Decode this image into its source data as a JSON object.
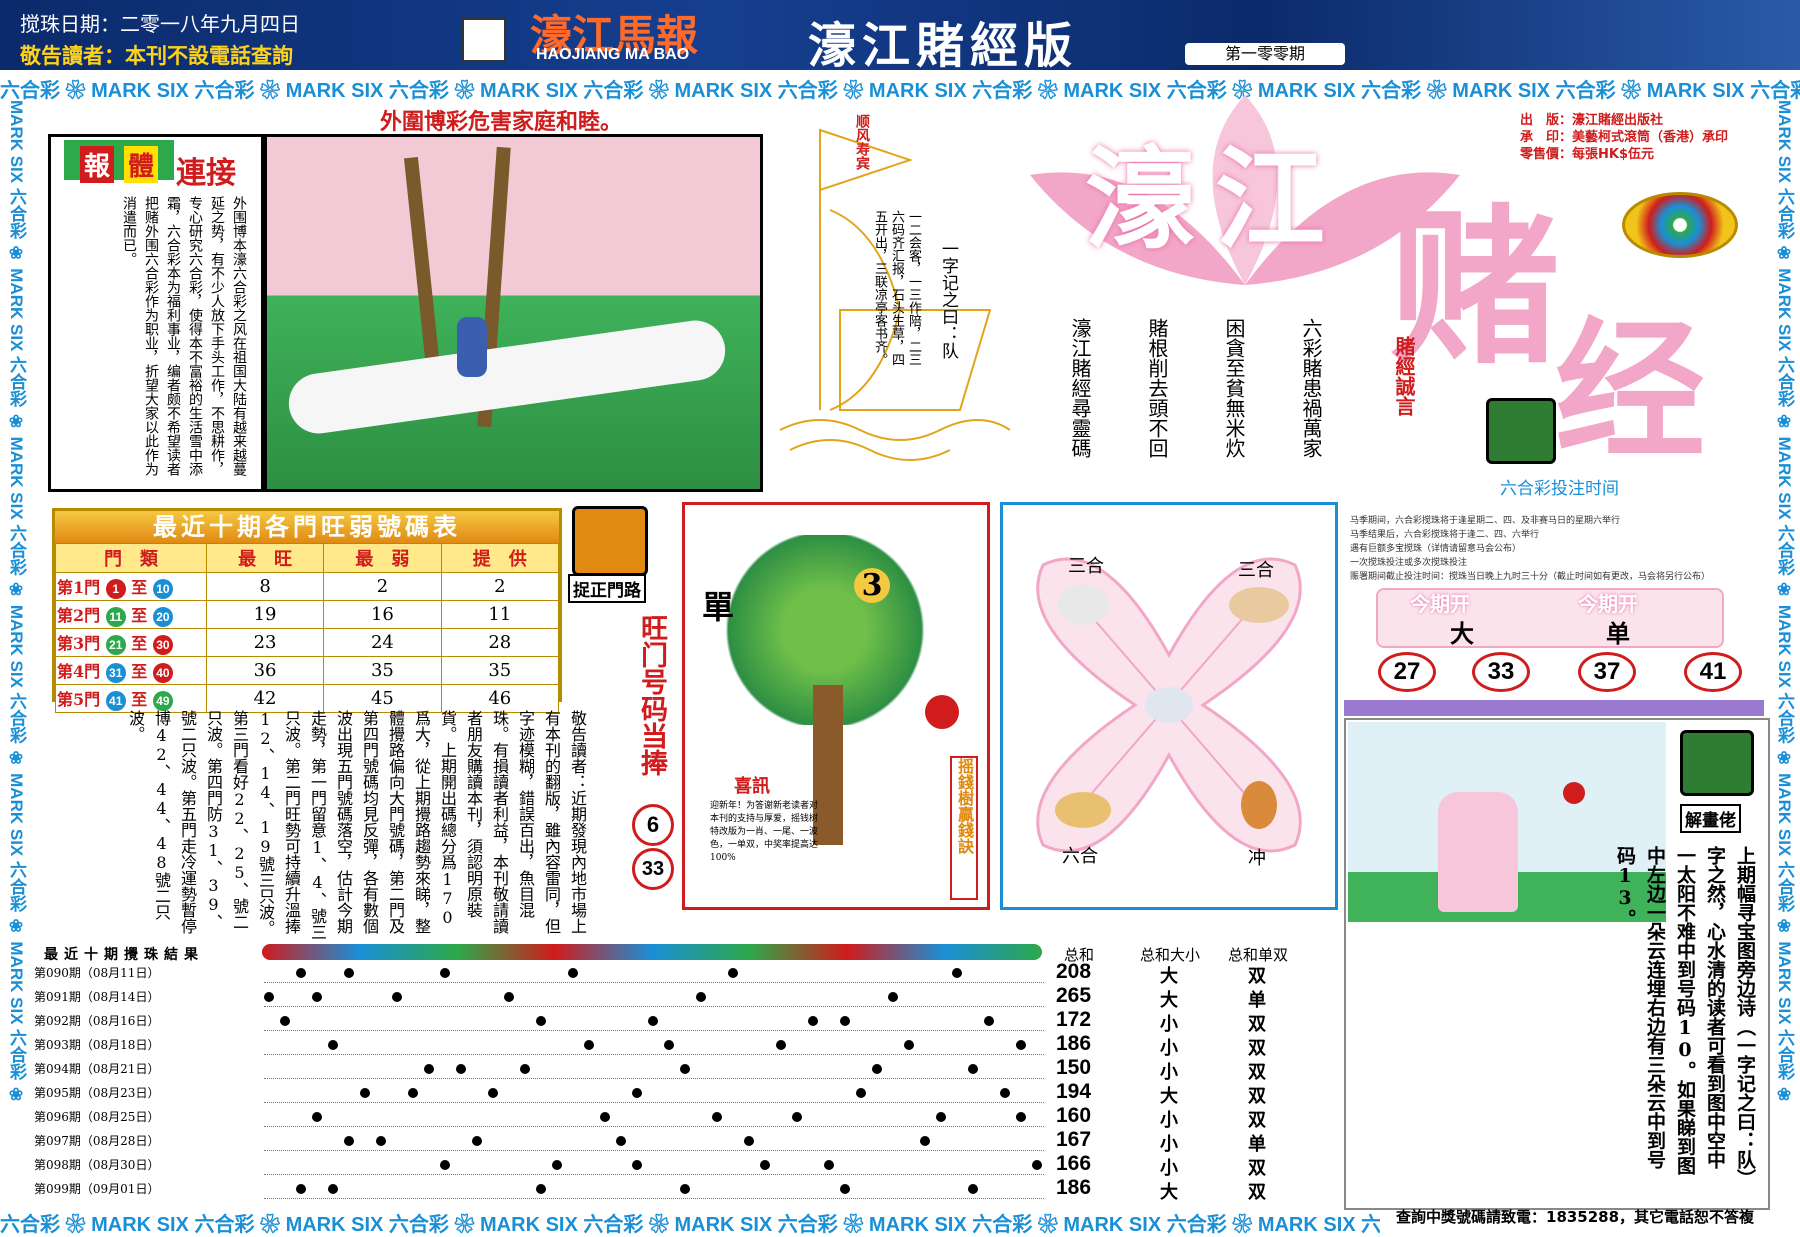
{
  "header": {
    "date": "搅珠日期：二零一八年九月四日",
    "notice": "敬告讀者：本刊不設電話查詢",
    "logo_cn": "濠江馬報",
    "logo_en": "HAOJIANG MA BAO",
    "edition": "濠江賭經版",
    "issue": "第一零零期"
  },
  "band_text": "六合彩 ❀ MARK SIX 六合彩 ❀ MARK SIX 六合彩 ❀ MARK SIX 六合彩 ❀ MARK SIX 六合彩 ❀ MARK SIX 六合彩 ❀ MARK SIX 六合彩 ❀ MARK SIX 六合彩 ❀ MARK SIX 六合彩 ❀ MARK SIX 六合彩 ❀ MARK SIX",
  "side_text": "MARK SIX 六合彩 ❀ MARK SIX 六合彩 ❀ MARK SIX 六合彩 ❀ MARK SIX 六合彩 ❀ MARK SIX 六合彩 ❀ MARK SIX 六合彩 ❀",
  "headline": "外圍博彩危害家庭和睦。",
  "article1": {
    "badge1": "報",
    "badge2": "體",
    "badge3": "連接",
    "body": "外围博本濠六合彩之风在祖国大陆有越来越蔓延之势，有不少人放下手头工作，不思耕作，专心研究六合彩，使得本不富裕的生活雪中添霜，六合彩本为福利事业，编者颇不希望读者把赌外围六合彩作为职业，折望大家以此作为消遣而已。"
  },
  "sail": {
    "flag": "顺风寿宾",
    "riddle": "一字记之曰：队",
    "poem": "一二会客，一三作陪，二三六码齐汇报，石头生草，四五开出，三联凉亭客书齐。"
  },
  "big_title": {
    "t1": "濠江",
    "t2": "赌",
    "t3": "经"
  },
  "proverb": {
    "lines": [
      "六彩賭患禍萬家",
      "困貪至貧無米炊",
      "賭根削去頭不回",
      "濠江賭經尋靈碼"
    ],
    "label": "賭經誠言"
  },
  "publisher": {
    "lines": [
      "出　版：濠江賭經出版社",
      "承　印：美藝柯式滾筒（香港）承印",
      "零售價：每張HK$伍元"
    ]
  },
  "bet_time_label": "六合彩投注时间",
  "table10": {
    "title": "最近十期各門旺弱號碼表",
    "headers": [
      "門　類",
      "最　旺",
      "最　弱",
      "提　供"
    ],
    "rows": [
      {
        "door": "第1門",
        "from": "1",
        "to": "10",
        "vals": [
          "8",
          "2",
          "2"
        ]
      },
      {
        "door": "第2門",
        "from": "11",
        "to": "20",
        "vals": [
          "19",
          "16",
          "11"
        ]
      },
      {
        "door": "第3門",
        "from": "21",
        "to": "30",
        "vals": [
          "23",
          "24",
          "28"
        ]
      },
      {
        "door": "第4門",
        "from": "31",
        "to": "40",
        "vals": [
          "36",
          "35",
          "35"
        ]
      },
      {
        "door": "第5門",
        "from": "41",
        "to": "49",
        "vals": [
          "42",
          "45",
          "46"
        ]
      }
    ]
  },
  "zhuozheng": {
    "label": "捉正門路",
    "hot_title": "旺门号码当捧",
    "hot1": "6",
    "hot2": "33"
  },
  "article2": {
    "body": "敬告讀者：近期發現內地市場上有本刊的翻版，雖內容雷同，但字迹模糊，錯誤百出，魚目混珠。有損讀者利益，本刊敬請讀者朋友購讀本刊，須認明原裝貨。上期開出碼總分爲170爲大，從上期攪路趨勢來睇，整體攪路偏向大門號碼，第二門及第四門號碼均見反彈，各有數個波出現五門號碼落空，估計今期走勢，第一門留意1、4、號三只波。第二門旺勢可持續升溫捧12、14、19號三只波。第三門看好22、25、號二只波。第四門防31、39、號二只波。第五門走冷運勢暫停博42、44、48號二只波。"
  },
  "tree": {
    "dan": "單",
    "num": "3",
    "xixun": "喜訊",
    "xixun_body": "迎新年！为答谢新老读者对本刊的支持与厚爱，摇钱树特改版为一肖、一尾、一波色，一单双，中奖率提高达100%",
    "side": "摇錢樹贏錢訣"
  },
  "zodiac": {
    "tl": "三合",
    "tr": "三合",
    "bl": "六合",
    "br": "冲"
  },
  "rules": {
    "lines": [
      "马季期间，六合彩搅珠将于逢星期二、四、及非赛马日的星期六举行",
      "马季结果后，六合彩搅珠将于逢二、四、六举行",
      "遇有巨额多宝搅珠（详情请留意马会公布）",
      "一次搅珠投注或多次搅珠投注",
      "赈署期间截止投注时间：搅珠当日晚上九时三十分（截止时间如有更改，马会将另行公布）"
    ]
  },
  "this_period": {
    "label": "今期开",
    "v1": "大",
    "v2": "单",
    "balls": [
      "27",
      "33",
      "37",
      "41"
    ]
  },
  "jiehua": {
    "label": "解畫佬",
    "body": "上期幅寻宝图旁边诗（一字记之曰：队）字之然，心水清的读者可看到图中空中一太阳不难中到号码10。如果睇到图中左边一朵云连埋右边有三朵云中到号码13。"
  },
  "results": {
    "title": "最近十期攪珠結果",
    "col_sum": "总和",
    "col_size": "总和大小",
    "col_odd": "总和单双",
    "rows": [
      {
        "label": "第090期（08月11日）",
        "sum": "208",
        "size": "大",
        "odd": "双"
      },
      {
        "label": "第091期（08月14日）",
        "sum": "265",
        "size": "大",
        "odd": "单"
      },
      {
        "label": "第092期（08月16日）",
        "sum": "172",
        "size": "小",
        "odd": "双"
      },
      {
        "label": "第093期（08月18日）",
        "sum": "186",
        "size": "小",
        "odd": "双"
      },
      {
        "label": "第094期（08月21日）",
        "sum": "150",
        "size": "小",
        "odd": "双"
      },
      {
        "label": "第095期（08月23日）",
        "sum": "194",
        "size": "大",
        "odd": "双"
      },
      {
        "label": "第096期（08月25日）",
        "sum": "160",
        "size": "小",
        "odd": "双"
      },
      {
        "label": "第097期（08月28日）",
        "sum": "167",
        "size": "小",
        "odd": "单"
      },
      {
        "label": "第098期（08月30日）",
        "sum": "166",
        "size": "小",
        "odd": "双"
      },
      {
        "label": "第099期（09月01日）",
        "sum": "186",
        "size": "大",
        "odd": "双"
      }
    ]
  },
  "footer": {
    "phone": "查詢中獎號碼請致電：1835288，其它電話恕不答複"
  },
  "colors": {
    "red": "#d01c1c",
    "blue": "#1a8fd6",
    "pink": "#f2a6c8",
    "navy": "#0b2a6b"
  }
}
